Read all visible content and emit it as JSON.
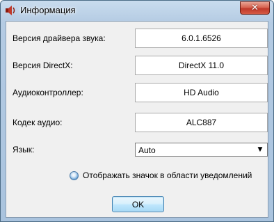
{
  "window": {
    "title": "Информация",
    "close_label": "✕",
    "icon": "speaker-icon",
    "accent_color": "#c0392b"
  },
  "rows": [
    {
      "label": "Версия драйвера звука:",
      "value": "6.0.1.6526"
    },
    {
      "label": "Версия DirectX:",
      "value": "DirectX 11.0"
    },
    {
      "label": "Аудиоконтроллер:",
      "value": "HD Audio"
    },
    {
      "label": "Кодек аудио:",
      "value": "ALC887"
    }
  ],
  "language": {
    "label": "Язык:",
    "selected": "Auto"
  },
  "notification": {
    "label": "Отображать значок в области уведомлений",
    "checked": true
  },
  "ok_label": "OK"
}
